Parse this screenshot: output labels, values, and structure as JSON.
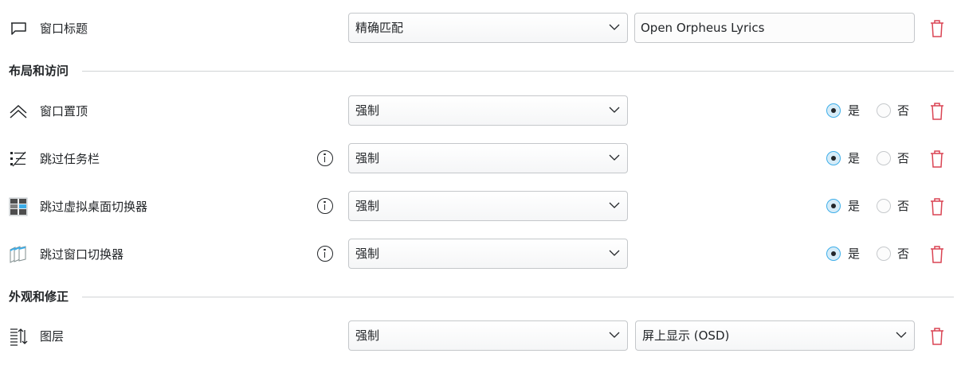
{
  "rows": [
    {
      "label": "窗口标题",
      "icon": "window-title-icon",
      "select": "精确匹配",
      "value": "Open Orpheus Lyrics"
    },
    {
      "label": "窗口置顶",
      "icon": "keep-above-icon",
      "select": "强制",
      "yes": "是",
      "no": "否",
      "selected": "yes"
    },
    {
      "label": "跳过任务栏",
      "icon": "skip-taskbar-icon",
      "select": "强制",
      "yes": "是",
      "no": "否",
      "selected": "yes"
    },
    {
      "label": "跳过虚拟桌面切换器",
      "icon": "skip-pager-icon",
      "select": "强制",
      "yes": "是",
      "no": "否",
      "selected": "yes"
    },
    {
      "label": "跳过窗口切换器",
      "icon": "skip-switcher-icon",
      "select": "强制",
      "yes": "是",
      "no": "否",
      "selected": "yes"
    },
    {
      "label": "图层",
      "icon": "layer-icon",
      "select": "强制",
      "value": "屏上显示 (OSD)"
    }
  ],
  "sections": {
    "layout": "布局和访问",
    "appearance": "外观和修正"
  },
  "colors": {
    "accent": "#3daee9",
    "delete": "#da4453",
    "border": "#c4c7ca",
    "text": "#232629"
  }
}
